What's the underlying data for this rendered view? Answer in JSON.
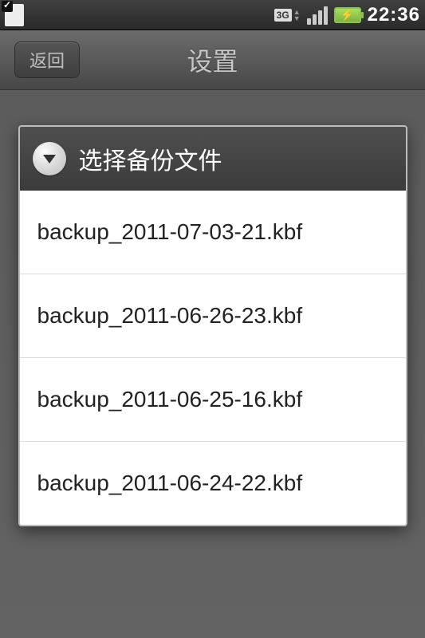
{
  "statusbar": {
    "threeg_label": "3G",
    "time": "22:36"
  },
  "header": {
    "back_label": "返回",
    "title": "设置"
  },
  "dialog": {
    "title": "选择备份文件",
    "items": [
      {
        "label": "backup_2011-07-03-21.kbf"
      },
      {
        "label": "backup_2011-06-26-23.kbf"
      },
      {
        "label": "backup_2011-06-25-16.kbf"
      },
      {
        "label": "backup_2011-06-24-22.kbf"
      }
    ]
  }
}
